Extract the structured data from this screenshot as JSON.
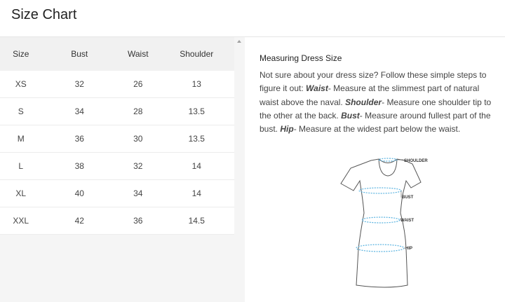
{
  "header": {
    "title": "Size Chart"
  },
  "table": {
    "columns": [
      "Size",
      "Bust",
      "Waist",
      "Shoulder"
    ],
    "rows": [
      [
        "XS",
        "32",
        "26",
        "13"
      ],
      [
        "S",
        "34",
        "28",
        "13.5"
      ],
      [
        "M",
        "36",
        "30",
        "13.5"
      ],
      [
        "L",
        "38",
        "32",
        "14"
      ],
      [
        "XL",
        "40",
        "34",
        "14"
      ],
      [
        "XXL",
        "42",
        "36",
        "14.5"
      ]
    ]
  },
  "guide": {
    "heading": "Measuring Dress Size",
    "intro": "Not sure about your dress size? Follow these simple steps to figure it out:",
    "items": [
      {
        "term": "Waist",
        "text": "- Measure at the slimmest part of natural waist above the naval."
      },
      {
        "term": "Shoulder",
        "text": "- Measure one shoulder tip to the other at the back."
      },
      {
        "term": "Bust",
        "text": "- Measure around fullest part of the bust."
      },
      {
        "term": "Hip",
        "text": "- Measure at the widest part below the waist."
      }
    ]
  },
  "diagram": {
    "labels": {
      "shoulder": "SHOULDER",
      "bust": "BUST",
      "waist": "WAIST",
      "hip": "HIP"
    }
  }
}
